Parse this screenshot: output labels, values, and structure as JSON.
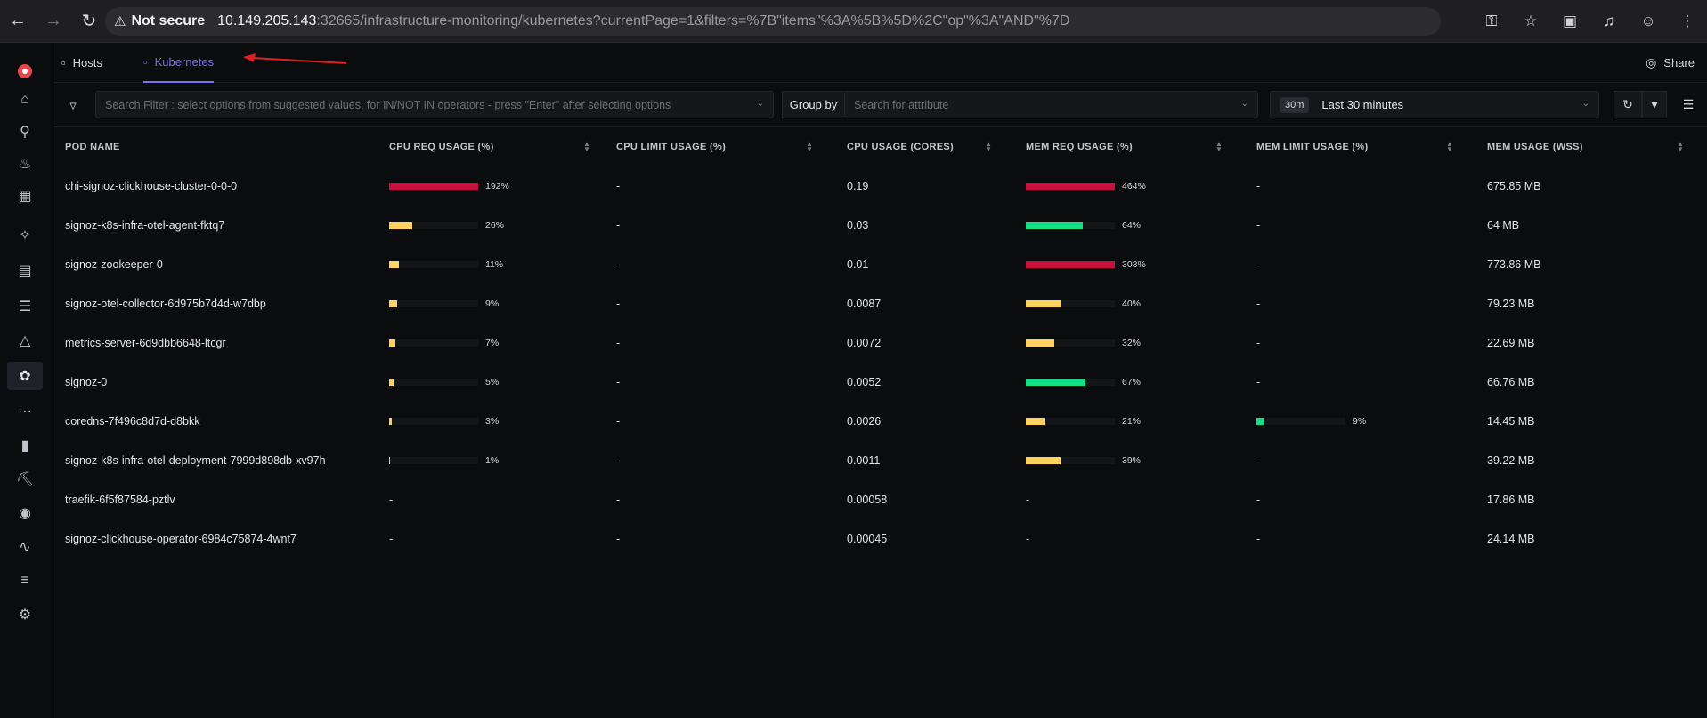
{
  "browser": {
    "not_secure": "Not secure",
    "url_host": "10.149.205.143",
    "url_rest": ":32665/infrastructure-monitoring/kubernetes?currentPage=1&filters=%7B\"items\"%3A%5B%5D%2C\"op\"%3A\"AND\"%7D"
  },
  "tabs": [
    {
      "label": "Hosts",
      "icon": "inbox-icon",
      "active": false
    },
    {
      "label": "Kubernetes",
      "icon": "inbox-icon",
      "active": true
    }
  ],
  "share_label": "Share",
  "filters": {
    "search_placeholder": "Search Filter : select options from suggested values, for IN/NOT IN operators - press \"Enter\" after selecting options",
    "group_by_label": "Group by",
    "group_by_placeholder": "Search for attribute",
    "time_badge": "30m",
    "time_range": "Last 30 minutes"
  },
  "table": {
    "columns": [
      "POD NAME",
      "CPU REQ USAGE (%)",
      "CPU LIMIT USAGE (%)",
      "CPU USAGE (CORES)",
      "MEM REQ USAGE (%)",
      "MEM LIMIT USAGE (%)",
      "MEM USAGE (WSS)"
    ],
    "rows": [
      {
        "pod": "chi-signoz-clickhouse-cluster-0-0-0",
        "cpu_req": "192%",
        "cpu_req_v": 192,
        "cpu_limit": "-",
        "cpu_limit_v": null,
        "cpu_cores": "0.19",
        "mem_req": "464%",
        "mem_req_v": 464,
        "mem_limit": "-",
        "mem_limit_v": null,
        "mem_wss": "675.85 MB"
      },
      {
        "pod": "signoz-k8s-infra-otel-agent-fktq7",
        "cpu_req": "26%",
        "cpu_req_v": 26,
        "cpu_limit": "-",
        "cpu_limit_v": null,
        "cpu_cores": "0.03",
        "mem_req": "64%",
        "mem_req_v": 64,
        "mem_limit": "-",
        "mem_limit_v": null,
        "mem_wss": "64 MB"
      },
      {
        "pod": "signoz-zookeeper-0",
        "cpu_req": "11%",
        "cpu_req_v": 11,
        "cpu_limit": "-",
        "cpu_limit_v": null,
        "cpu_cores": "0.01",
        "mem_req": "303%",
        "mem_req_v": 303,
        "mem_limit": "-",
        "mem_limit_v": null,
        "mem_wss": "773.86 MB"
      },
      {
        "pod": "signoz-otel-collector-6d975b7d4d-w7dbp",
        "cpu_req": "9%",
        "cpu_req_v": 9,
        "cpu_limit": "-",
        "cpu_limit_v": null,
        "cpu_cores": "0.0087",
        "mem_req": "40%",
        "mem_req_v": 40,
        "mem_limit": "-",
        "mem_limit_v": null,
        "mem_wss": "79.23 MB"
      },
      {
        "pod": "metrics-server-6d9dbb6648-ltcgr",
        "cpu_req": "7%",
        "cpu_req_v": 7,
        "cpu_limit": "-",
        "cpu_limit_v": null,
        "cpu_cores": "0.0072",
        "mem_req": "32%",
        "mem_req_v": 32,
        "mem_limit": "-",
        "mem_limit_v": null,
        "mem_wss": "22.69 MB"
      },
      {
        "pod": "signoz-0",
        "cpu_req": "5%",
        "cpu_req_v": 5,
        "cpu_limit": "-",
        "cpu_limit_v": null,
        "cpu_cores": "0.0052",
        "mem_req": "67%",
        "mem_req_v": 67,
        "mem_limit": "-",
        "mem_limit_v": null,
        "mem_wss": "66.76 MB"
      },
      {
        "pod": "coredns-7f496c8d7d-d8bkk",
        "cpu_req": "3%",
        "cpu_req_v": 3,
        "cpu_limit": "-",
        "cpu_limit_v": null,
        "cpu_cores": "0.0026",
        "mem_req": "21%",
        "mem_req_v": 21,
        "mem_limit": "9%",
        "mem_limit_v": 9,
        "mem_wss": "14.45 MB"
      },
      {
        "pod": "signoz-k8s-infra-otel-deployment-7999d898db-xv97h",
        "cpu_req": "1%",
        "cpu_req_v": 1,
        "cpu_limit": "-",
        "cpu_limit_v": null,
        "cpu_cores": "0.0011",
        "mem_req": "39%",
        "mem_req_v": 39,
        "mem_limit": "-",
        "mem_limit_v": null,
        "mem_wss": "39.22 MB"
      },
      {
        "pod": "traefik-6f5f87584-pztlv",
        "cpu_req": "-",
        "cpu_req_v": null,
        "cpu_limit": "-",
        "cpu_limit_v": null,
        "cpu_cores": "0.00058",
        "mem_req": "-",
        "mem_req_v": null,
        "mem_limit": "-",
        "mem_limit_v": null,
        "mem_wss": "17.86 MB"
      },
      {
        "pod": "signoz-clickhouse-operator-6984c75874-4wnt7",
        "cpu_req": "-",
        "cpu_req_v": null,
        "cpu_limit": "-",
        "cpu_limit_v": null,
        "cpu_cores": "0.00045",
        "mem_req": "-",
        "mem_req_v": null,
        "mem_limit": "-",
        "mem_limit_v": null,
        "mem_wss": "24.14 MB"
      }
    ]
  },
  "colors": {
    "accent": "#7b6ff2",
    "bar_red": "#c8103e",
    "bar_yellow": "#ffd25e",
    "bar_green": "#14e08a",
    "annotation_arrow": "#e02020"
  }
}
